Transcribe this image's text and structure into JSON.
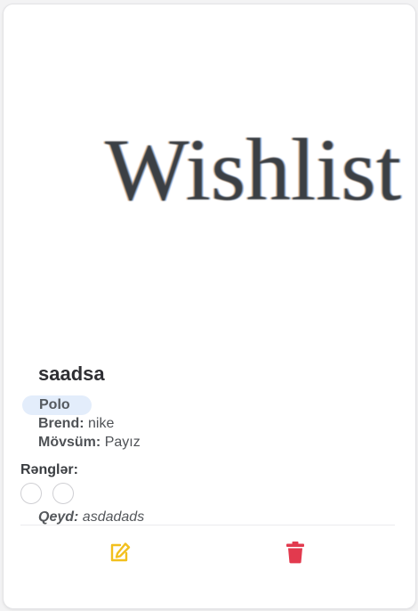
{
  "image": {
    "text": "Wishlist"
  },
  "product": {
    "name": "saadsa",
    "type": "Polo",
    "brand_label": "Brend:",
    "brand_value": "nike",
    "season_label": "Mövsüm:",
    "season_value": "Payız",
    "colors_heading": "Rənglər:",
    "colors": [
      "#ffffff",
      "#ffffff"
    ],
    "note_label": "Qeyd:",
    "note_value": "asdadads"
  },
  "actions": {
    "edit_icon": "edit-icon",
    "edit_color": "#f2c01e",
    "delete_icon": "trash-icon",
    "delete_color": "#e23a4e"
  },
  "colors": {
    "badge_bg": "#e3edfb"
  }
}
